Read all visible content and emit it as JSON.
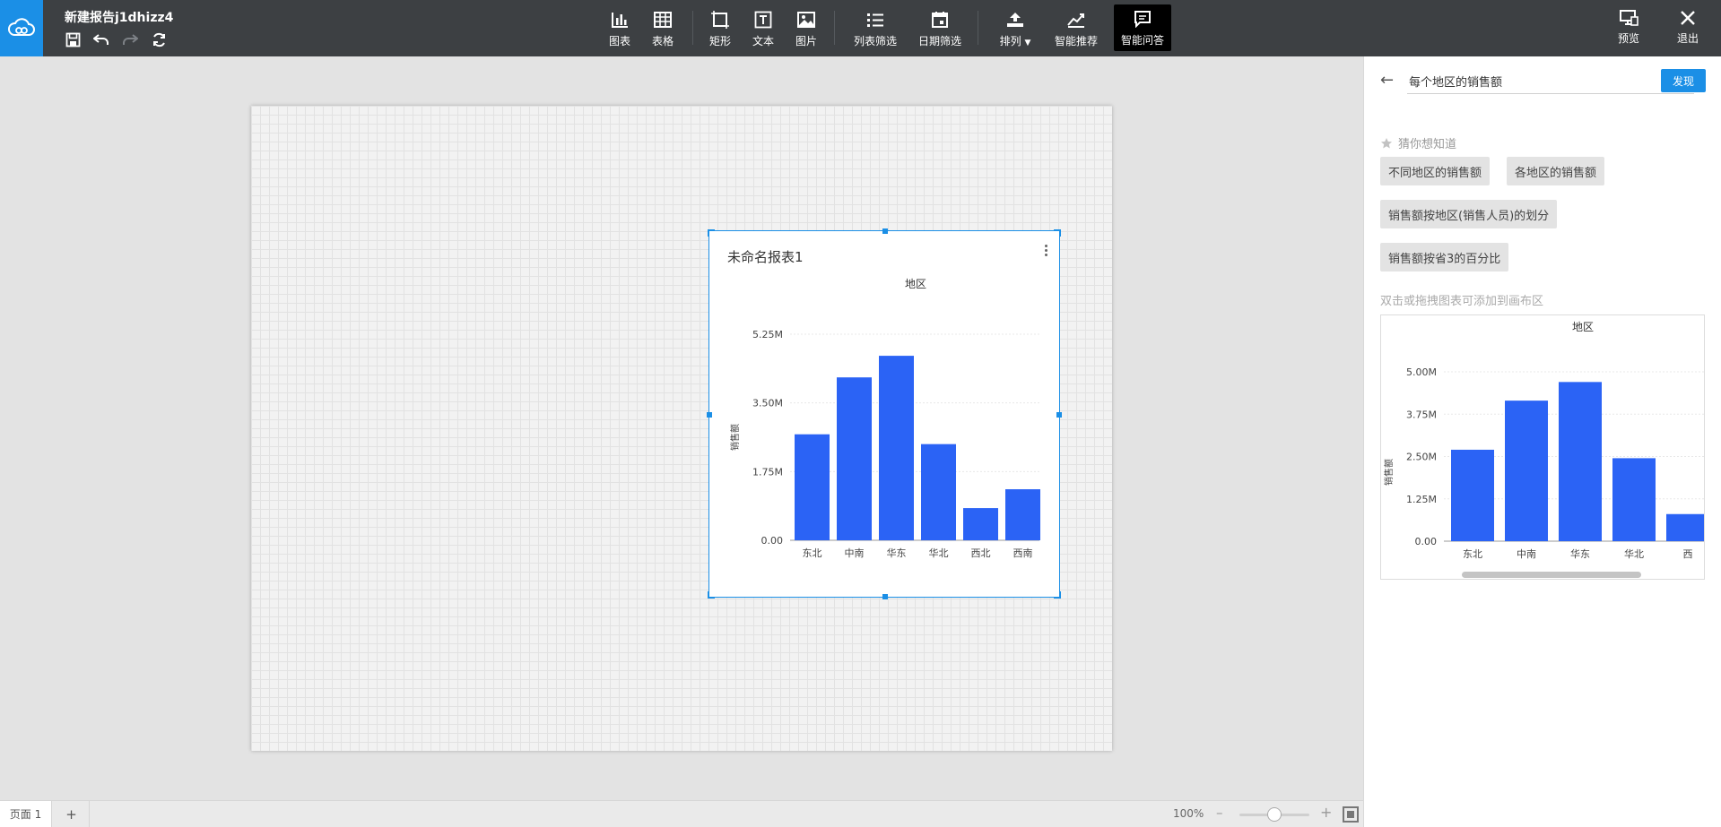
{
  "app": {
    "brand_color": "#1b8fe6",
    "title": "新建报告j1dhizz4"
  },
  "quick_actions": [
    {
      "name": "save-icon"
    },
    {
      "name": "undo-icon"
    },
    {
      "name": "redo-icon"
    },
    {
      "name": "refresh-icon"
    }
  ],
  "toolbar": {
    "chart": "图表",
    "table": "表格",
    "rectangle": "矩形",
    "text": "文本",
    "image": "图片",
    "list_filter": "列表筛选",
    "date_filter": "日期筛选",
    "arrange": "排列",
    "smart_recommend": "智能推荐",
    "smart_qa": "智能问答",
    "preview": "预览",
    "exit": "退出"
  },
  "canvas": {
    "card_title": "未命名报表1",
    "chart_data": {
      "type": "bar",
      "title": "地区",
      "ylabel": "销售额",
      "xlabel": "",
      "categories": [
        "东北",
        "中南",
        "华东",
        "华北",
        "西北",
        "西南"
      ],
      "values": [
        2700000,
        4150000,
        4700000,
        2450000,
        820000,
        1300000
      ],
      "yticks": [
        "0.00",
        "1.75M",
        "3.50M",
        "5.25M"
      ],
      "ylim": [
        0,
        5250000
      ],
      "grid": true,
      "color": "#2b63f5"
    }
  },
  "statusbar": {
    "page_tab": "页面 1",
    "add_page": "+",
    "zoom": "100%",
    "zoom_minus": "–",
    "zoom_plus": "+"
  },
  "panel": {
    "query": "每个地区的销售额",
    "discover_label": "发现",
    "guess_title": "猜你想知道",
    "suggestions": [
      "不同地区的销售额",
      "各地区的销售额",
      "销售额按地区(销售人员)的划分",
      "销售额按省3的百分比"
    ],
    "hint": "双击或拖拽图表可添加到画布区",
    "preview_chart": {
      "type": "bar",
      "title": "地区",
      "ylabel": "销售额",
      "categories": [
        "东北",
        "中南",
        "华东",
        "华北",
        "西"
      ],
      "values": [
        2700000,
        4150000,
        4700000,
        2450000,
        800000
      ],
      "yticks": [
        "0.00",
        "1.25M",
        "2.50M",
        "3.75M",
        "5.00M"
      ],
      "ylim": [
        0,
        5000000
      ],
      "grid": true,
      "color": "#2b63f5"
    }
  }
}
